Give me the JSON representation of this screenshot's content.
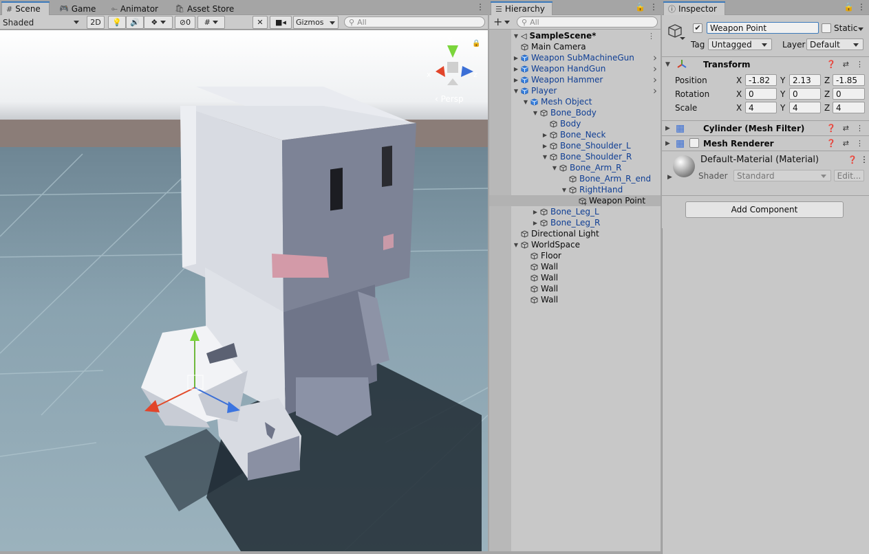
{
  "scene_panel": {
    "tabs": [
      "Scene",
      "Game",
      "Animator",
      "Asset Store"
    ],
    "shading_mode": "Shaded",
    "toggle_2d": "2D",
    "hidden_count": "0",
    "gizmos": "Gizmos",
    "search_placeholder": "All",
    "gizmo_persp": "Persp",
    "axis_x": "x",
    "axis_y": "y",
    "axis_z": "z"
  },
  "hierarchy": {
    "title": "Hierarchy",
    "search_placeholder": "All",
    "scene_name": "SampleScene*",
    "items": [
      {
        "label": "Main Camera",
        "depth": 1,
        "arrow": "",
        "prefab": false
      },
      {
        "label": "Weapon SubMachineGun",
        "depth": 1,
        "arrow": "▶",
        "prefab": true,
        "chevron": true
      },
      {
        "label": "Weapon HandGun",
        "depth": 1,
        "arrow": "▶",
        "prefab": true,
        "chevron": true
      },
      {
        "label": "Weapon Hammer",
        "depth": 1,
        "arrow": "▶",
        "prefab": true,
        "chevron": true
      },
      {
        "label": "Player",
        "depth": 1,
        "arrow": "▼",
        "prefab": true,
        "chevron": true
      },
      {
        "label": "Mesh Object",
        "depth": 2,
        "arrow": "▼",
        "prefab": true
      },
      {
        "label": "Bone_Body",
        "depth": 3,
        "arrow": "▼",
        "prefab": false,
        "blue": true
      },
      {
        "label": "Body",
        "depth": 4,
        "arrow": "",
        "prefab": false,
        "blue": true
      },
      {
        "label": "Bone_Neck",
        "depth": 4,
        "arrow": "▶",
        "prefab": false,
        "blue": true
      },
      {
        "label": "Bone_Shoulder_L",
        "depth": 4,
        "arrow": "▶",
        "prefab": false,
        "blue": true
      },
      {
        "label": "Bone_Shoulder_R",
        "depth": 4,
        "arrow": "▼",
        "prefab": false,
        "blue": true
      },
      {
        "label": "Bone_Arm_R",
        "depth": 5,
        "arrow": "▼",
        "prefab": false,
        "blue": true
      },
      {
        "label": "Bone_Arm_R_end",
        "depth": 6,
        "arrow": "",
        "prefab": false,
        "blue": true
      },
      {
        "label": "RightHand",
        "depth": 6,
        "arrow": "▼",
        "prefab": false,
        "blue": true
      },
      {
        "label": "Weapon Point",
        "depth": 7,
        "arrow": "",
        "prefab": false,
        "selected": true,
        "added": true
      },
      {
        "label": "Bone_Leg_L",
        "depth": 3,
        "arrow": "▶",
        "prefab": false,
        "blue": true
      },
      {
        "label": "Bone_Leg_R",
        "depth": 3,
        "arrow": "▶",
        "prefab": false,
        "blue": true
      },
      {
        "label": "Directional Light",
        "depth": 1,
        "arrow": "",
        "prefab": false
      },
      {
        "label": "WorldSpace",
        "depth": 1,
        "arrow": "▼",
        "prefab": false
      },
      {
        "label": "Floor",
        "depth": 2,
        "arrow": "",
        "prefab": false
      },
      {
        "label": "Wall",
        "depth": 2,
        "arrow": "",
        "prefab": false
      },
      {
        "label": "Wall",
        "depth": 2,
        "arrow": "",
        "prefab": false
      },
      {
        "label": "Wall",
        "depth": 2,
        "arrow": "",
        "prefab": false
      },
      {
        "label": "Wall",
        "depth": 2,
        "arrow": "",
        "prefab": false
      }
    ]
  },
  "inspector": {
    "title": "Inspector",
    "object_name": "Weapon Point",
    "static_label": "Static",
    "tag_label": "Tag",
    "tag_value": "Untagged",
    "layer_label": "Layer",
    "layer_value": "Default",
    "transform": {
      "title": "Transform",
      "position_label": "Position",
      "rotation_label": "Rotation",
      "scale_label": "Scale",
      "position": {
        "x": "-1.82",
        "y": "2.13",
        "z": "-1.85"
      },
      "rotation": {
        "x": "0",
        "y": "0",
        "z": "0"
      },
      "scale": {
        "x": "4",
        "y": "4",
        "z": "4"
      },
      "axis_x": "X",
      "axis_y": "Y",
      "axis_z": "Z"
    },
    "mesh_filter_title": "Cylinder (Mesh Filter)",
    "mesh_renderer_title": "Mesh Renderer",
    "material_name": "Default-Material (Material)",
    "shader_label": "Shader",
    "shader_value": "Standard",
    "edit_button": "Edit...",
    "add_component": "Add Component"
  },
  "colors": {
    "panel_bg": "#c8c8c8",
    "selection": "#b2b2b2",
    "prefab_blue": "#0f3e94",
    "active_tab_accent": "#3a79bb"
  }
}
